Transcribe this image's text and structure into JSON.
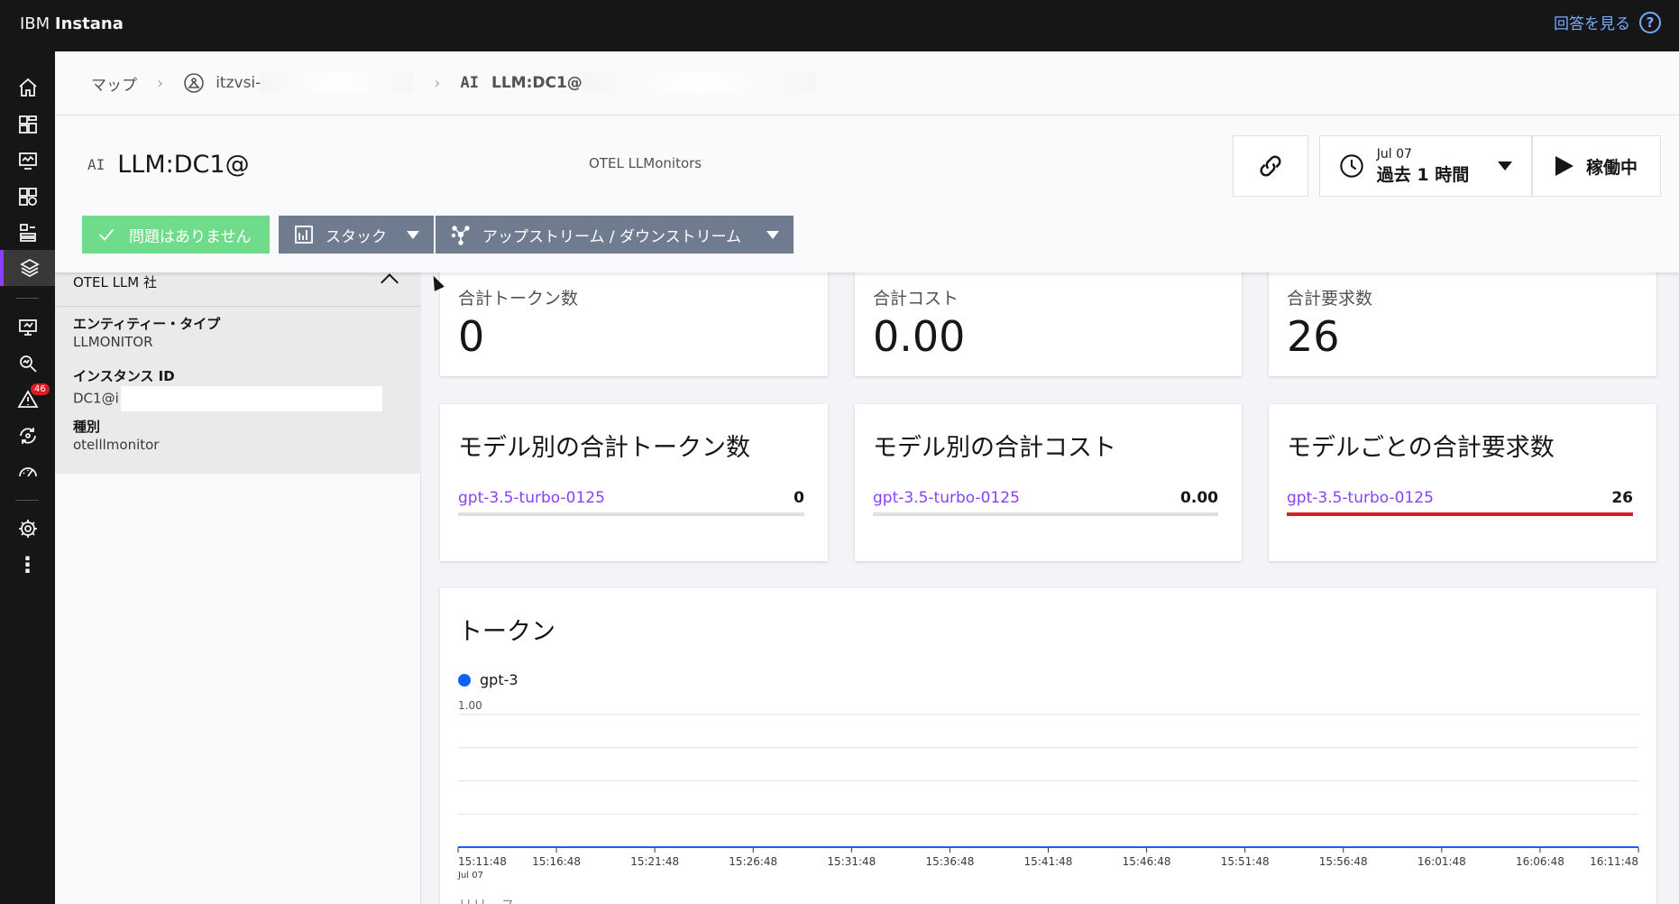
{
  "app": {
    "brand_prefix": "IBM",
    "brand_name": "Instana",
    "help_label": "回答を見る",
    "help_icon": "?"
  },
  "rail": {
    "alert_count": "46"
  },
  "breadcrumb": {
    "items": [
      "マップ",
      "itzvsi-",
      "LLM:DC1@"
    ],
    "ai_tag": "AI"
  },
  "entity": {
    "ai_tag": "AI",
    "title": "LLM:DC1@",
    "subtitle": "OTEL LLMonitors"
  },
  "timepicker": {
    "date": "Jul 07",
    "range": "過去 1 時間"
  },
  "live": {
    "label": "稼働中"
  },
  "buttons": {
    "ok": "問題はありません",
    "stack": "スタック",
    "updown": "アップストリーム / ダウンストリーム"
  },
  "sidebar": {
    "section": "OTEL LLM 社",
    "props": [
      {
        "label": "エンティティー・タイプ",
        "value": "LLMONITOR"
      },
      {
        "label": "インスタンス ID",
        "value": "DC1@i"
      },
      {
        "label": "種別",
        "value": "otelllmonitor"
      }
    ]
  },
  "kpis": [
    {
      "label": "合計トークン数",
      "value": "0"
    },
    {
      "label": "合計コスト",
      "value": "0.00"
    },
    {
      "label": "合計要求数",
      "value": "26"
    }
  ],
  "model_cards": [
    {
      "title": "モデル別の合計トークン数",
      "model": "gpt-3.5-turbo-0125",
      "value": "0",
      "fill": 0
    },
    {
      "title": "モデル別の合計コスト",
      "model": "gpt-3.5-turbo-0125",
      "value": "0.00",
      "fill": 0
    },
    {
      "title": "モデルごとの合計要求数",
      "model": "gpt-3.5-turbo-0125",
      "value": "26",
      "fill": 1
    }
  ],
  "chart_data": {
    "type": "line",
    "title": "トークン",
    "series": [
      {
        "name": "gpt-3",
        "color": "#0f62fe",
        "values": [
          0,
          0,
          0,
          0,
          0,
          0,
          0,
          0,
          0,
          0,
          0,
          0,
          0
        ]
      }
    ],
    "x": [
      "15:11:48",
      "15:16:48",
      "15:21:48",
      "15:26:48",
      "15:31:48",
      "15:36:48",
      "15:41:48",
      "15:46:48",
      "15:51:48",
      "15:56:48",
      "16:01:48",
      "16:06:48",
      "16:11:48"
    ],
    "x_sublabel": "Jul 07",
    "y_tick_label": "1.00",
    "ylim": [
      0,
      1
    ],
    "grid": true
  },
  "next_section": "リリース"
}
